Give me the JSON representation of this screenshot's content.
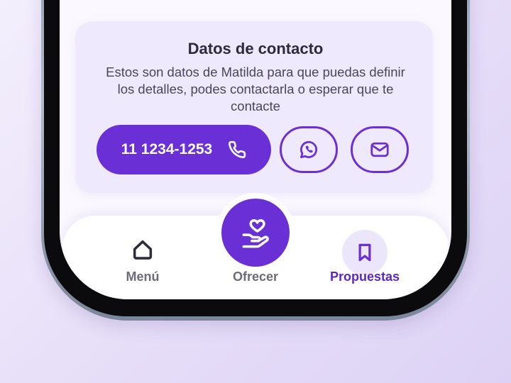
{
  "contact_card": {
    "title": "Datos de contacto",
    "description": "Estos son datos de Matilda para que puedas definir los detalles, podes contactarla o esperar que te contacte",
    "phone_number": "11 1234-1253"
  },
  "nav": {
    "menu_label": "Menú",
    "offer_label": "Ofrecer",
    "proposals_label": "Propuestas",
    "active_item": "Propuestas"
  },
  "icons": {
    "phone": "phone-icon",
    "whatsapp": "whatsapp-icon",
    "email": "mail-icon",
    "menu": "home-icon",
    "offer": "hand-heart-icon",
    "proposals": "bookmark-icon"
  },
  "colors": {
    "accent": "#6b2fd6",
    "active_label": "#5b26c2",
    "inactive_label": "#6e6b78",
    "card_background": "#efe9fd"
  }
}
